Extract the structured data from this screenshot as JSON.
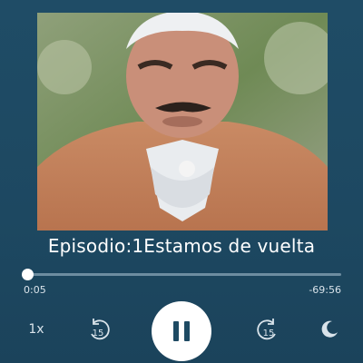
{
  "episode": {
    "title": "Episodio:1Estamos de vuelta"
  },
  "artwork": {
    "icon": "cover-art-image"
  },
  "playback": {
    "elapsed": "0:05",
    "remaining": "-69:56",
    "progress_fraction": 0.0012,
    "speed_label": "1x",
    "skip_back_seconds": "15",
    "skip_forward_seconds": "15",
    "state": "playing"
  },
  "colors": {
    "background": "#1e4a63",
    "accent": "#ffffff"
  }
}
